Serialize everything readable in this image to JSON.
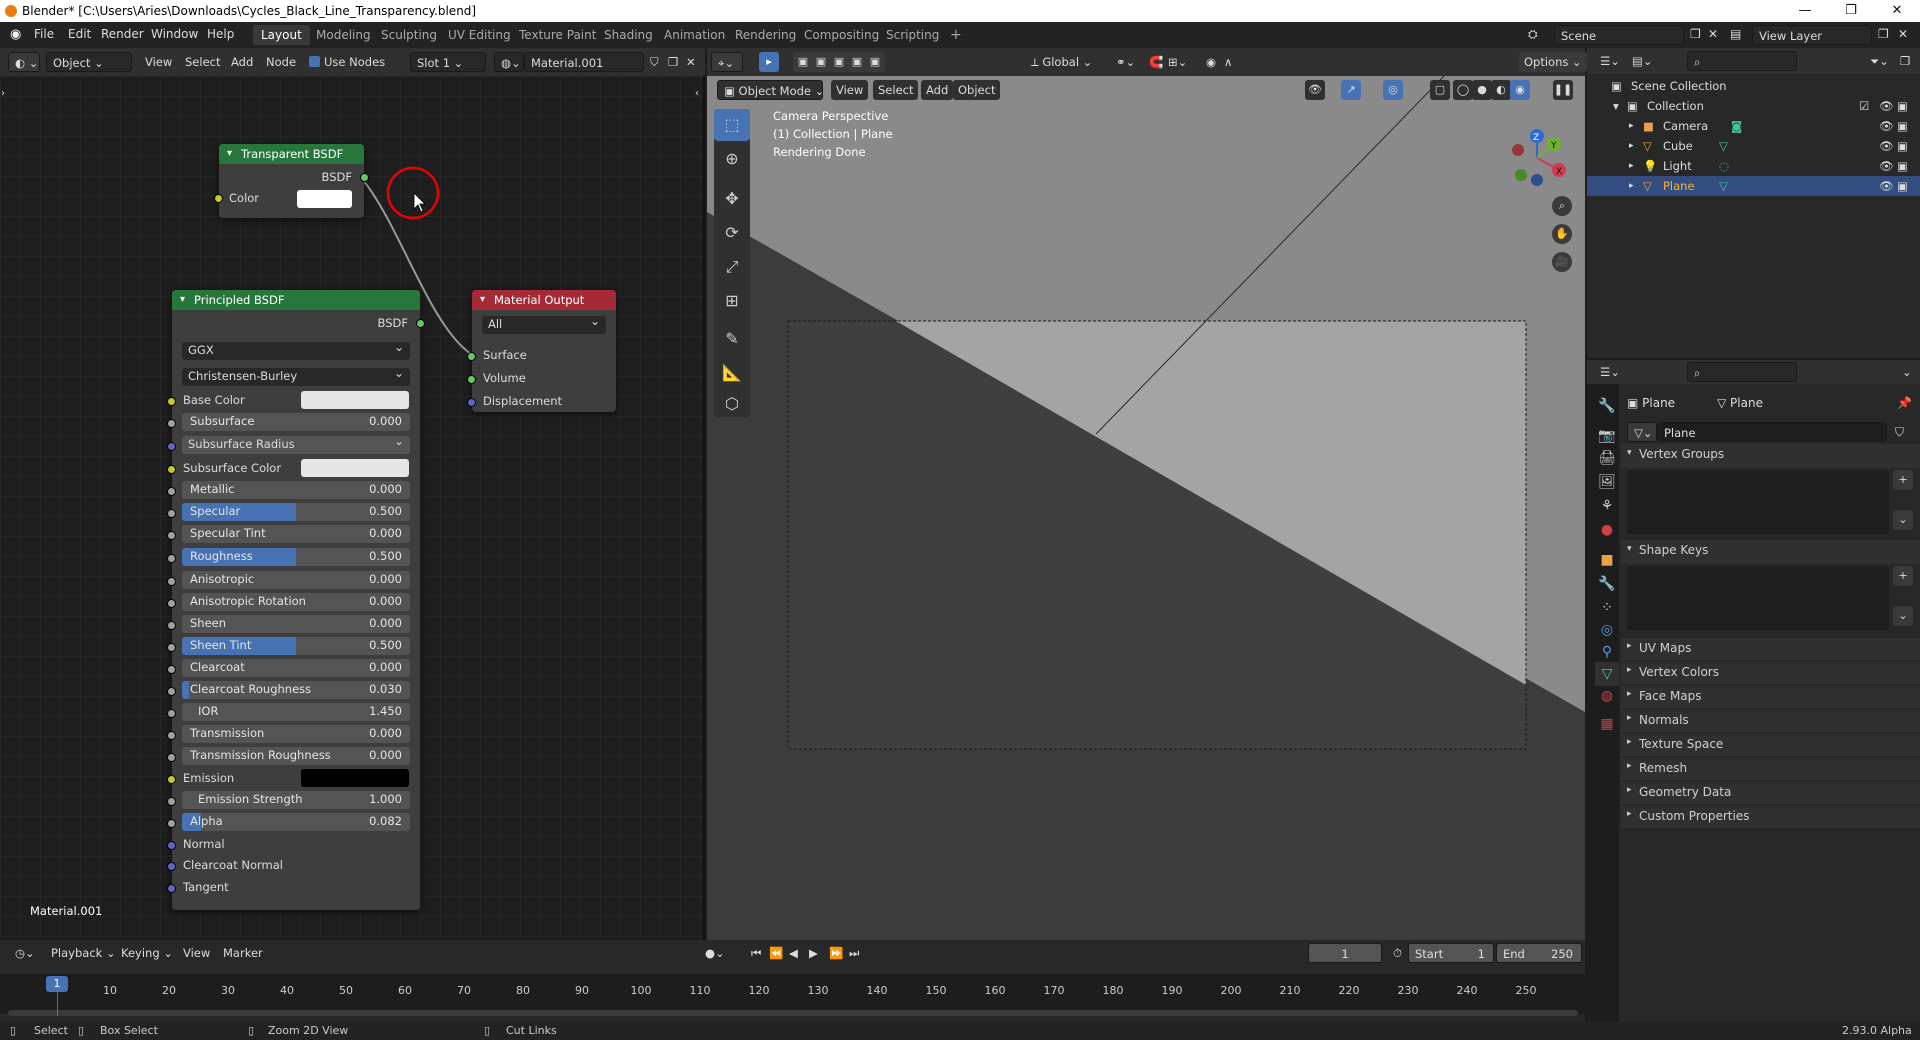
{
  "window": {
    "title": "Blender* [C:\\Users\\Aries\\Downloads\\Cycles_Black_Line_Transparency.blend]",
    "minimize": "—",
    "maximize": "❐",
    "close": "✕"
  },
  "menubar": {
    "items": [
      "File",
      "Edit",
      "Render",
      "Window",
      "Help"
    ]
  },
  "workspaces": [
    "Layout",
    "Modeling",
    "Sculpting",
    "UV Editing",
    "Texture Paint",
    "Shading",
    "Animation",
    "Rendering",
    "Compositing",
    "Scripting"
  ],
  "add_workspace": "+",
  "scene": {
    "label": "Scene",
    "view_layer": "View Layer"
  },
  "node_editor": {
    "header": {
      "mode": "Object",
      "view": "View",
      "select": "Select",
      "add": "Add",
      "node": "Node",
      "use_nodes": "Use Nodes",
      "slot": "Slot 1",
      "material": "Material.001"
    },
    "material_label": "Material.001",
    "transparent_node": {
      "title": "Transparent BSDF",
      "output": "BSDF",
      "input": "Color",
      "color": "#ffffff"
    },
    "output_node": {
      "title": "Material Output",
      "target": "All",
      "inputs": [
        "Surface",
        "Volume",
        "Displacement"
      ]
    },
    "principled_node": {
      "title": "Principled BSDF",
      "output": "BSDF",
      "distribution": "GGX",
      "subsurface_method": "Christensen-Burley",
      "base_color_label": "Base Color",
      "base_color": "#e6e6e6",
      "subsurface": {
        "label": "Subsurface",
        "value": "0.000",
        "fill": 0
      },
      "subsurface_radius": "Subsurface Radius",
      "subsurface_color_label": "Subsurface Color",
      "subsurface_color": "#e6e6e6",
      "metallic": {
        "label": "Metallic",
        "value": "0.000",
        "fill": 0
      },
      "specular": {
        "label": "Specular",
        "value": "0.500",
        "fill": 0.5
      },
      "specular_tint": {
        "label": "Specular Tint",
        "value": "0.000",
        "fill": 0
      },
      "roughness": {
        "label": "Roughness",
        "value": "0.500",
        "fill": 0.5
      },
      "anisotropic": {
        "label": "Anisotropic",
        "value": "0.000",
        "fill": 0
      },
      "anisotropic_rotation": {
        "label": "Anisotropic Rotation",
        "value": "0.000",
        "fill": 0
      },
      "sheen": {
        "label": "Sheen",
        "value": "0.000",
        "fill": 0
      },
      "sheen_tint": {
        "label": "Sheen Tint",
        "value": "0.500",
        "fill": 0.5
      },
      "clearcoat": {
        "label": "Clearcoat",
        "value": "0.000",
        "fill": 0
      },
      "clearcoat_roughness": {
        "label": "Clearcoat Roughness",
        "value": "0.030",
        "fill": 0.03
      },
      "ior": {
        "label": "IOR",
        "value": "1.450"
      },
      "transmission": {
        "label": "Transmission",
        "value": "0.000",
        "fill": 0
      },
      "transmission_roughness": {
        "label": "Transmission Roughness",
        "value": "0.000",
        "fill": 0
      },
      "emission_label": "Emission",
      "emission_color": "#000000",
      "emission_strength": {
        "label": "Emission Strength",
        "value": "1.000"
      },
      "alpha": {
        "label": "Alpha",
        "value": "0.082",
        "fill": 0.082
      },
      "normal": "Normal",
      "clearcoat_normal": "Clearcoat Normal",
      "tangent": "Tangent"
    }
  },
  "viewport": {
    "header": {
      "mode": "Object Mode",
      "view": "View",
      "select": "Select",
      "add": "Add",
      "object": "Object",
      "transform": "Global",
      "options": "Options"
    },
    "overlay_text": [
      "Camera Perspective",
      "(1) Collection | Plane",
      "Rendering Done"
    ],
    "gizmo": {
      "z": "Z",
      "y": "Y",
      "x": "X"
    }
  },
  "outliner": {
    "root": "Scene Collection",
    "collection": "Collection",
    "items": [
      {
        "name": "Camera",
        "icon": "camera-icon"
      },
      {
        "name": "Cube",
        "icon": "mesh-icon"
      },
      {
        "name": "Light",
        "icon": "light-icon"
      },
      {
        "name": "Plane",
        "icon": "mesh-icon",
        "selected": true
      }
    ]
  },
  "properties": {
    "breadcrumb": [
      "Plane",
      "Plane"
    ],
    "data_name": "Plane",
    "panels": [
      "Vertex Groups",
      "Shape Keys",
      "UV Maps",
      "Vertex Colors",
      "Face Maps",
      "Normals",
      "Texture Space",
      "Remesh",
      "Geometry Data",
      "Custom Properties"
    ]
  },
  "timeline": {
    "playback": "Playback",
    "keying": "Keying",
    "view": "View",
    "marker": "Marker",
    "current_frame": "1",
    "start_label": "Start",
    "start": "1",
    "end_label": "End",
    "end": "250",
    "ticks": [
      "10",
      "20",
      "30",
      "40",
      "50",
      "60",
      "70",
      "80",
      "90",
      "100",
      "110",
      "120",
      "130",
      "140",
      "150",
      "160",
      "170",
      "180",
      "190",
      "200",
      "210",
      "220",
      "230",
      "240",
      "250"
    ],
    "playhead": "1"
  },
  "statusbar": {
    "select": "Select",
    "box_select": "Box Select",
    "zoom": "Zoom 2D View",
    "cut_links": "Cut Links",
    "version": "2.93.0 Alpha"
  },
  "colors": {
    "accent": "#4772b3",
    "node_green": "#27773d",
    "node_red": "#a52a35",
    "selection": "#334d80"
  }
}
